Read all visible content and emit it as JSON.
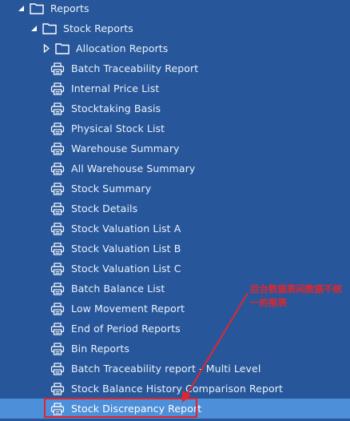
{
  "tree": {
    "root": {
      "label": "Reports",
      "expanded": true
    },
    "stock_reports": {
      "label": "Stock Reports",
      "expanded": true
    },
    "allocation_reports": {
      "label": "Allocation Reports",
      "expanded": false
    },
    "items": [
      {
        "label": "Batch Traceability Report"
      },
      {
        "label": "Internal Price List"
      },
      {
        "label": "Stocktaking Basis"
      },
      {
        "label": "Physical Stock List"
      },
      {
        "label": "Warehouse Summary"
      },
      {
        "label": "All Warehouse Summary"
      },
      {
        "label": "Stock Summary"
      },
      {
        "label": "Stock Details"
      },
      {
        "label": "Stock Valuation List A"
      },
      {
        "label": "Stock Valuation List B"
      },
      {
        "label": "Stock Valuation List C"
      },
      {
        "label": "Batch Balance List"
      },
      {
        "label": "Low Movement Report"
      },
      {
        "label": "End of Period Reports"
      },
      {
        "label": "Bin Reports"
      },
      {
        "label": "Batch Traceability report - Multi Level"
      },
      {
        "label": "Stock Balance History Comparison Report"
      },
      {
        "label": "Stock Discrepancy Report",
        "selected": true
      }
    ]
  },
  "annotation": {
    "text": "后台数据表间数据不统一的报表"
  },
  "colors": {
    "background": "#27579a",
    "selected_row": "#4d8fd9",
    "annotation_red": "#e3262d"
  }
}
